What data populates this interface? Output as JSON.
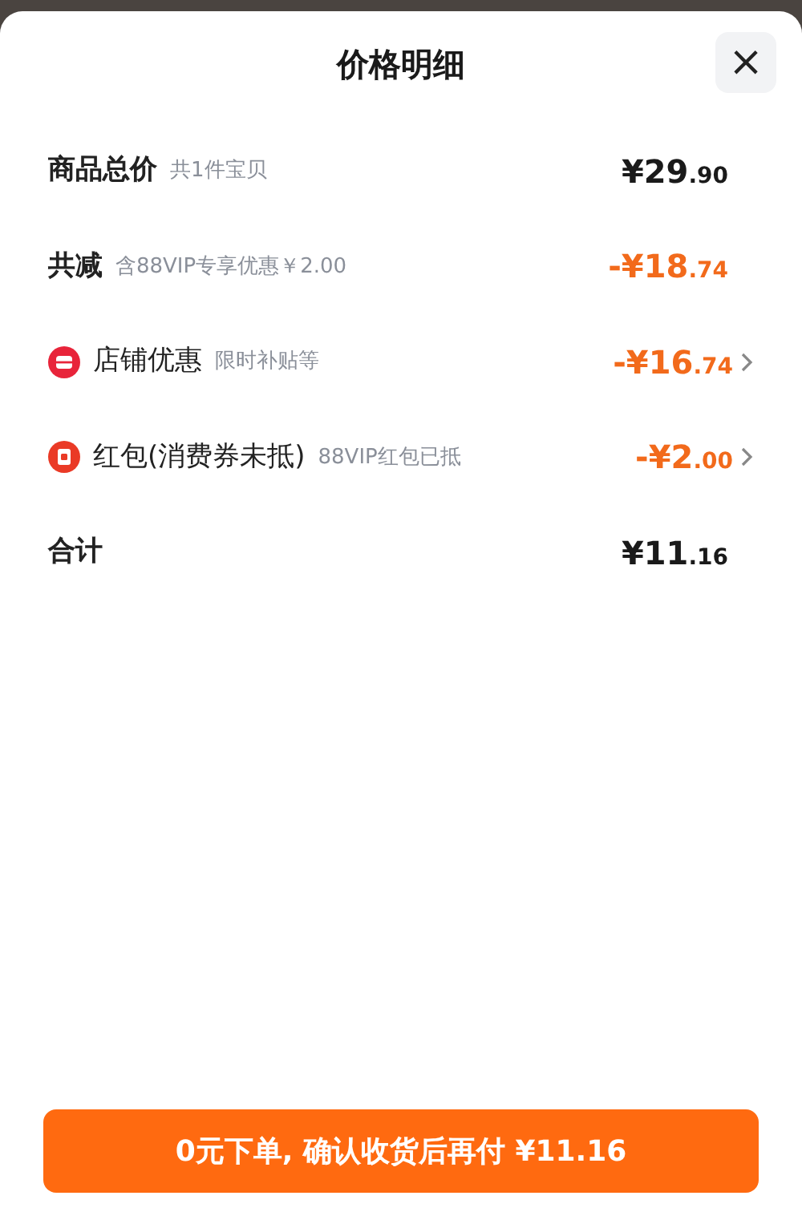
{
  "sheet": {
    "title": "价格明细",
    "close": "×"
  },
  "rows": [
    {
      "kind": "sum",
      "label": "商品总价",
      "note": "共1件宝贝",
      "amount": "¥29.90"
    },
    {
      "kind": "discount",
      "label": "共减",
      "note": "含88VIP专享优惠￥2.00",
      "amount": "-¥18.74"
    },
    {
      "kind": "store",
      "label": "店铺优惠",
      "note": "限时补贴等",
      "amount": "-¥16.74"
    },
    {
      "kind": "redpacket",
      "label": "红包(消费券未抵)",
      "note": "88VIP红包已抵",
      "amount": "-¥2.00"
    },
    {
      "kind": "sum",
      "label": "合计",
      "amount": "¥11.16"
    }
  ],
  "submit_button": "0元下单, 确认收货后再付 ¥11.16"
}
